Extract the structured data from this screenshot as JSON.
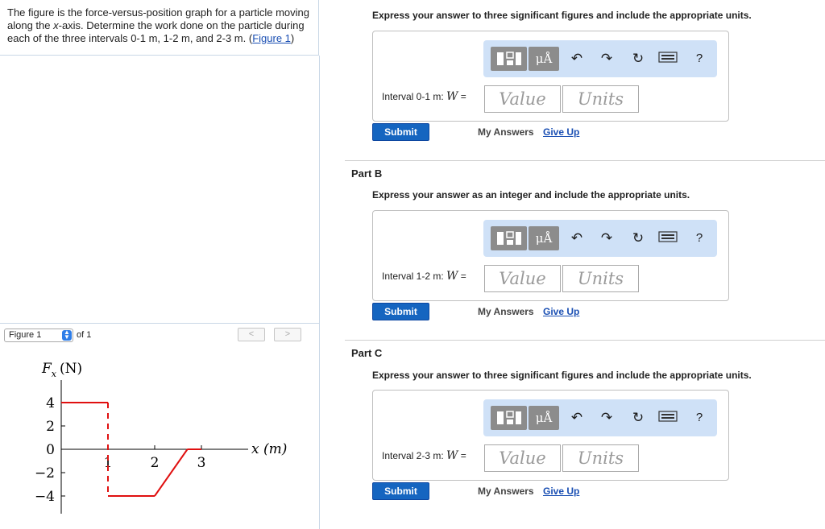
{
  "problem": {
    "text_before": "The figure is the force-versus-position graph for a particle moving along the ",
    "x_var": "x",
    "text_mid": "-axis. Determine the work done on the particle during each of the three intervals 0-1 m, 1-2 m, and 2-3 m. (",
    "figure_link": "Figure 1",
    "text_after": ")"
  },
  "figure": {
    "selector_value": "Figure 1",
    "of_text": "of 1",
    "prev": "<",
    "next": ">",
    "y_label_main": "F",
    "y_label_sub": "x",
    "y_label_unit": "(N)",
    "x_label": "x (m)",
    "chart_data": {
      "type": "line",
      "x": [
        0,
        1,
        1,
        1.33,
        2,
        2.1,
        3
      ],
      "y": [
        4,
        4,
        -4,
        -4,
        -4,
        -4,
        0
      ],
      "points": [
        [
          0,
          4
        ],
        [
          1,
          4
        ],
        [
          1,
          -4
        ],
        [
          2,
          -4
        ],
        [
          2.7,
          0
        ],
        [
          3,
          0
        ]
      ],
      "xlim": [
        0,
        3
      ],
      "ylim": [
        -4,
        4
      ],
      "x_ticks": [
        "1",
        "2",
        "3"
      ],
      "y_ticks": [
        "4",
        "2",
        "0",
        "−2",
        "−4"
      ],
      "xlabel": "x (m)",
      "ylabel": "Fx (N)",
      "colors": {
        "series": "#e01010",
        "axis": "#000000"
      }
    }
  },
  "parts": [
    {
      "title": "",
      "instruction": "Express your answer to three significant figures and include the appropriate units.",
      "label_prefix": "Interval 0-1 m: ",
      "var": "W",
      "label_suffix": " =",
      "value_placeholder": "Value",
      "units_placeholder": "Units",
      "submit": "Submit",
      "my_answers": "My Answers",
      "give_up": "Give Up"
    },
    {
      "title": "Part B",
      "instruction": "Express your answer as an integer and include the appropriate units.",
      "label_prefix": "Interval 1-2 m: ",
      "var": "W",
      "label_suffix": " =",
      "value_placeholder": "Value",
      "units_placeholder": "Units",
      "submit": "Submit",
      "my_answers": "My Answers",
      "give_up": "Give Up"
    },
    {
      "title": "Part C",
      "instruction": "Express your answer to three significant figures and include the appropriate units.",
      "label_prefix": "Interval 2-3 m: ",
      "var": "W",
      "label_suffix": " =",
      "value_placeholder": "Value",
      "units_placeholder": "Units",
      "submit": "Submit",
      "my_answers": "My Answers",
      "give_up": "Give Up"
    }
  ],
  "toolbar": {
    "mu_label": "μÅ",
    "undo_icon": "undo-icon",
    "redo_icon": "redo-icon",
    "reset_icon": "reset-icon",
    "keyboard_icon": "keyboard-icon",
    "help_label": "?"
  },
  "colors": {
    "toolbar_bg": "#cfe1f7",
    "submit_bg": "#1565c0",
    "link": "#1a4fb3"
  }
}
